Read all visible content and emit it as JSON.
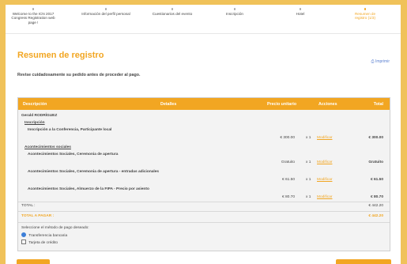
{
  "steps": [
    {
      "label": "Welcome to the ICN 2017 Congress Registration web page !",
      "active": false
    },
    {
      "label": "Información del perfil personal",
      "active": false
    },
    {
      "label": "Cuestionarios del evento",
      "active": false
    },
    {
      "label": "Inscripción",
      "active": false
    },
    {
      "label": "Hotel",
      "active": false
    },
    {
      "label": "Resumen de registro (1/3)",
      "active": true
    }
  ],
  "page_title": "Resumen de registro",
  "print_link": "Imprimir",
  "intro": "Revise cuidadosamente su pedido antes de proceder al pago.",
  "table": {
    "headers": {
      "description": "Descripción",
      "details": "Detalles",
      "unit_price": "Precio unitario",
      "actions": "Acciones",
      "total": "Total"
    },
    "person": "Gerald RODRÍGUEZ",
    "sections": [
      {
        "title": "Inscripción",
        "items": [
          {
            "name": "Inscripción a la Conferencia, Participante local",
            "price": "€ 300.00",
            "qty": "x 1",
            "action": "Modificar",
            "total": "€ 300.00"
          }
        ]
      },
      {
        "title": "Acontecimientos sociales",
        "items": [
          {
            "name": "Acontecimientos Sociales, Ceremonia de apertura",
            "price": "Gratuito",
            "qty": "x 1",
            "action": "Modificar",
            "total": "Gratuito"
          },
          {
            "name": "Acontecimientos Sociales, Ceremonia de apertura - entradas adicionales",
            "price": "€ 61.50",
            "qty": "x 1",
            "action": "Modificar",
            "total": "€ 61.50"
          },
          {
            "name": "Acontecimientos Sociales, Almuerzo de la FIPA - Precio por asiento",
            "price": "€ 80.70",
            "qty": "x 1",
            "action": "Modificar",
            "total": "€ 80.70"
          }
        ]
      }
    ],
    "total_label": "TOTAL :",
    "total_value": "€ 442.20",
    "to_pay_label": "TOTAL A PAGAR :",
    "to_pay_value": "€ 442.20"
  },
  "payment": {
    "prompt": "Seleccione el método de pago deseado:",
    "options": [
      {
        "label": "Transferencia bancaria",
        "checked": true,
        "kind": "radio"
      },
      {
        "label": "Tarjeta de crédito",
        "checked": false,
        "kind": "checkbox"
      }
    ]
  },
  "colors": {
    "accent": "#f2a622",
    "link": "#5a7fd0",
    "header_bg": "#f2a622"
  },
  "icons": {
    "print": "printer-icon"
  }
}
